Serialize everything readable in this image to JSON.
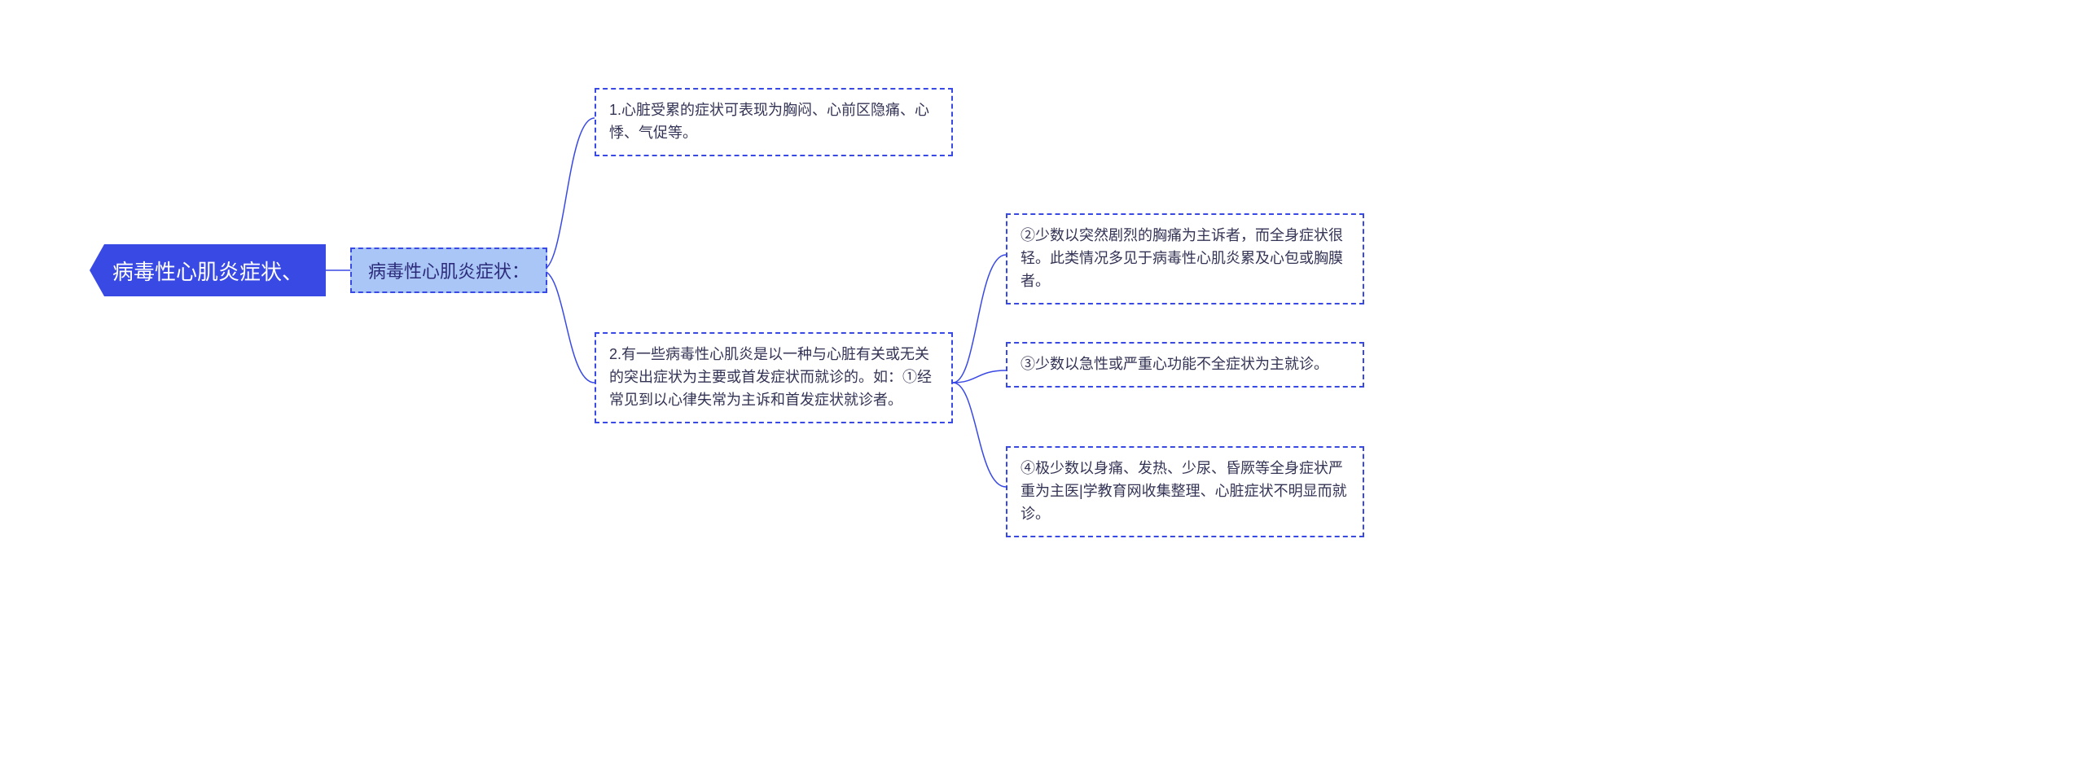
{
  "mindmap": {
    "root": {
      "text": "病毒性心肌炎症状、"
    },
    "level1": {
      "text": "病毒性心肌炎症状："
    },
    "nodeA": {
      "text": "1.心脏受累的症状可表现为胸闷、心前区隐痛、心悸、气促等。"
    },
    "nodeB": {
      "text": "2.有一些病毒性心肌炎是以一种与心脏有关或无关的突出症状为主要或首发症状而就诊的。如：①经常见到以心律失常为主诉和首发症状就诊者。"
    },
    "nodeC": {
      "text": "②少数以突然剧烈的胸痛为主诉者，而全身症状很轻。此类情况多见于病毒性心肌炎累及心包或胸膜者。"
    },
    "nodeD": {
      "text": "③少数以急性或严重心功能不全症状为主就诊。"
    },
    "nodeE": {
      "text": "④极少数以身痛、发热、少尿、昏厥等全身症状严重为主医|学教育网收集整理、心脏症状不明显而就诊。"
    }
  },
  "colors": {
    "primary": "#3949e4",
    "level1_bg": "#aac6f7",
    "text_dark": "#333355"
  },
  "chart_data": {
    "type": "mindmap",
    "title": "病毒性心肌炎症状、",
    "root": "病毒性心肌炎症状、",
    "children": [
      {
        "label": "病毒性心肌炎症状：",
        "children": [
          {
            "label": "1.心脏受累的症状可表现为胸闷、心前区隐痛、心悸、气促等。"
          },
          {
            "label": "2.有一些病毒性心肌炎是以一种与心脏有关或无关的突出症状为主要或首发症状而就诊的。如：①经常见到以心律失常为主诉和首发症状就诊者。",
            "children": [
              {
                "label": "②少数以突然剧烈的胸痛为主诉者，而全身症状很轻。此类情况多见于病毒性心肌炎累及心包或胸膜者。"
              },
              {
                "label": "③少数以急性或严重心功能不全症状为主就诊。"
              },
              {
                "label": "④极少数以身痛、发热、少尿、昏厥等全身症状严重为主医|学教育网收集整理、心脏症状不明显而就诊。"
              }
            ]
          }
        ]
      }
    ]
  }
}
